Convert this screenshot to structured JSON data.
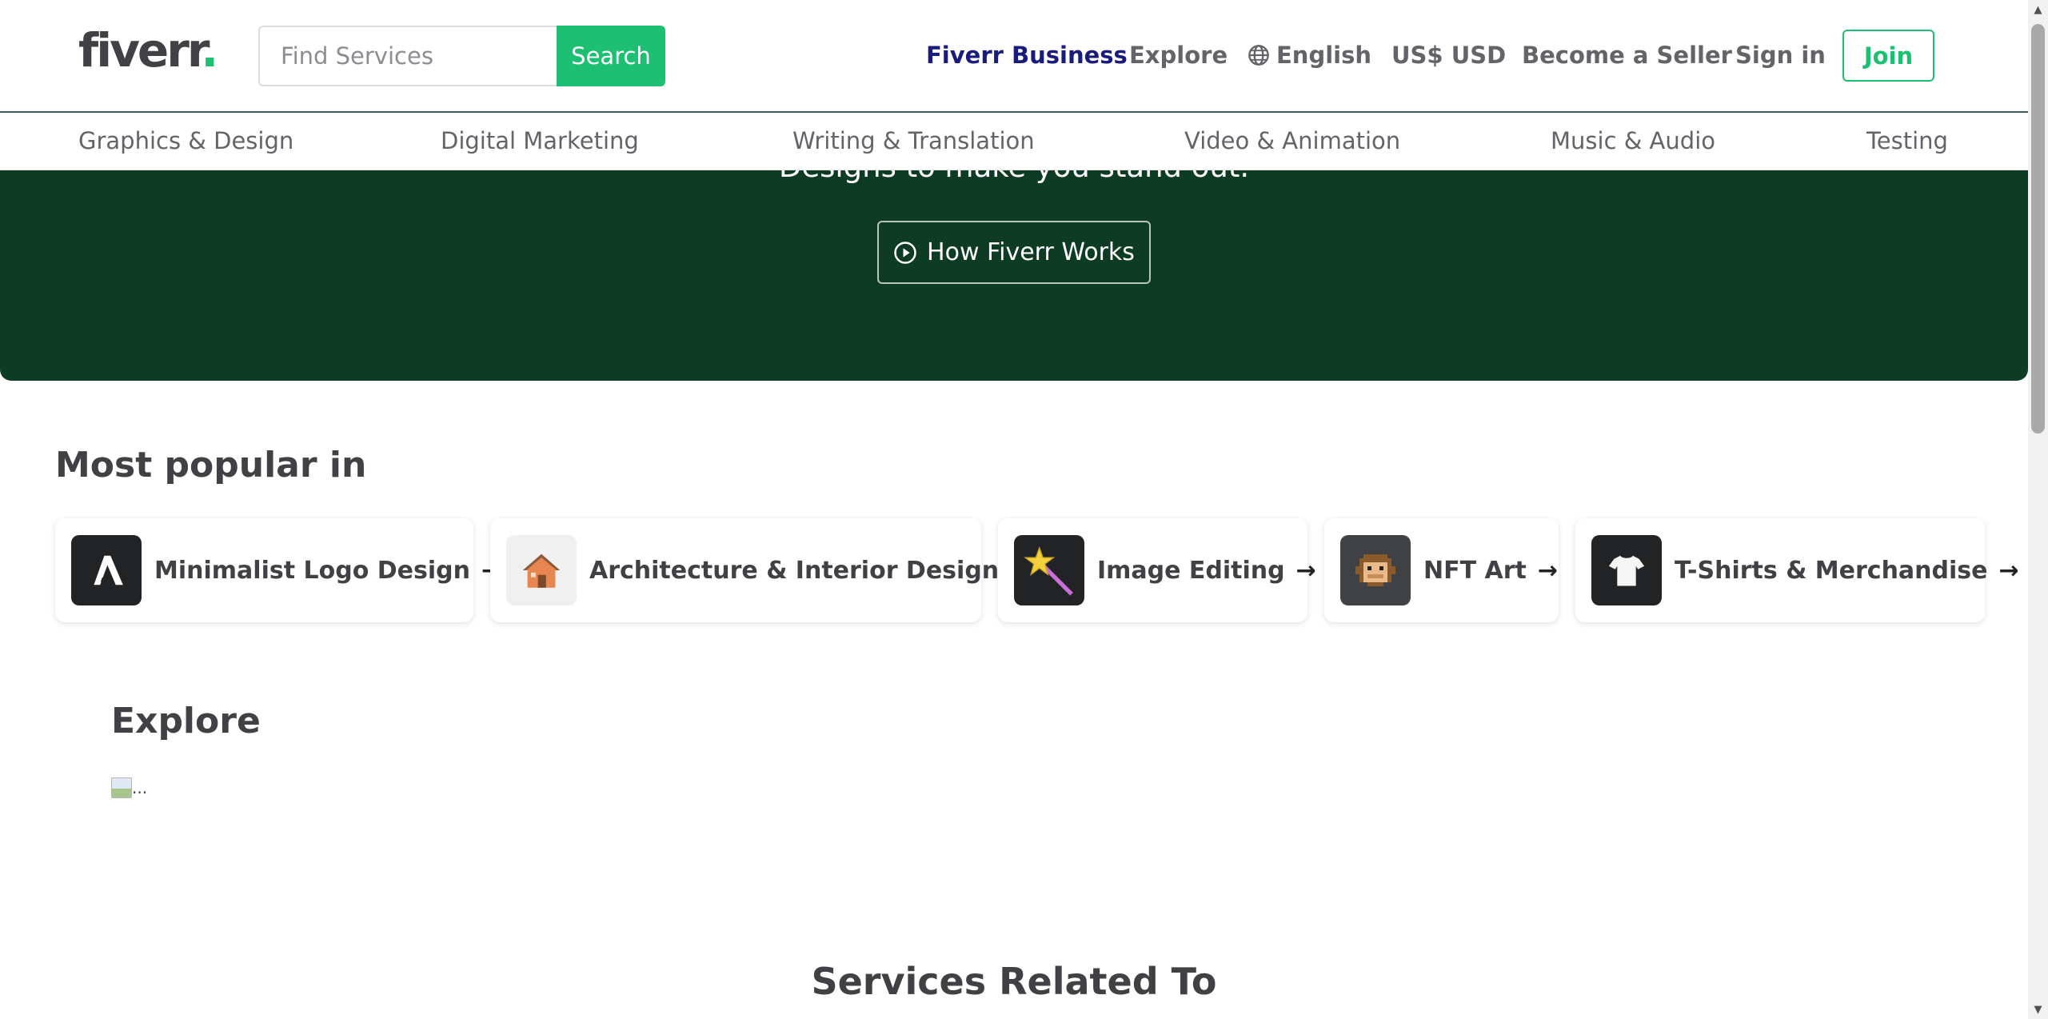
{
  "header": {
    "logo_text": "fiverr",
    "logo_dot": ".",
    "search_placeholder": "Find Services",
    "search_button": "Search",
    "nav": {
      "business": "Fiverr Business",
      "explore": "Explore",
      "language": "English",
      "currency": "US$ USD",
      "become_seller": "Become a Seller",
      "sign_in": "Sign in",
      "join": "Join"
    },
    "colors": {
      "brand": "#1dbf73",
      "business": "#1a1c7c"
    }
  },
  "categories": [
    "Graphics & Design",
    "Digital Marketing",
    "Writing & Translation",
    "Video & Animation",
    "Music & Audio",
    "Testing"
  ],
  "hero": {
    "subtitle": "Designs to make you stand out.",
    "how_button": "How Fiverr Works",
    "background": "#0d3b24"
  },
  "popular": {
    "title": "Most popular in",
    "items": [
      {
        "label": "Minimalist Logo Design",
        "icon": "logo-letter-a-icon"
      },
      {
        "label": "Architecture & Interior Design",
        "icon": "house-icon"
      },
      {
        "label": "Image Editing",
        "icon": "magic-wand-icon"
      },
      {
        "label": "NFT Art",
        "icon": "pixel-monkey-icon"
      },
      {
        "label": "T-Shirts & Merchandise",
        "icon": "tshirt-icon"
      }
    ],
    "arrow": "→"
  },
  "explore": {
    "title": "Explore",
    "broken_image_alt": "..."
  },
  "related": {
    "title": "Services Related To"
  }
}
